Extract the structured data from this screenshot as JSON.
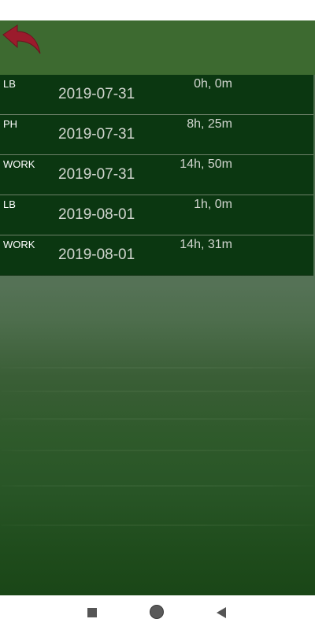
{
  "colors": {
    "header": "#3d6a30",
    "row_background": "#0b3711",
    "back_arrow": "#9b1b2c",
    "row_text": "#d2d6d0",
    "type_text": "#ffffff"
  },
  "header": {
    "back_icon": "back-arrow-icon"
  },
  "entries": [
    {
      "type": "LB",
      "date": "2019-07-31",
      "duration": "0h, 0m"
    },
    {
      "type": "PH",
      "date": "2019-07-31",
      "duration": "8h, 25m"
    },
    {
      "type": "WORK",
      "date": "2019-07-31",
      "duration": "14h, 50m"
    },
    {
      "type": "LB",
      "date": "2019-08-01",
      "duration": "1h, 0m"
    },
    {
      "type": "WORK",
      "date": "2019-08-01",
      "duration": "14h, 31m"
    }
  ],
  "nav": {
    "recents_icon": "square-icon",
    "home_icon": "circle-icon",
    "back_icon": "triangle-back-icon"
  }
}
